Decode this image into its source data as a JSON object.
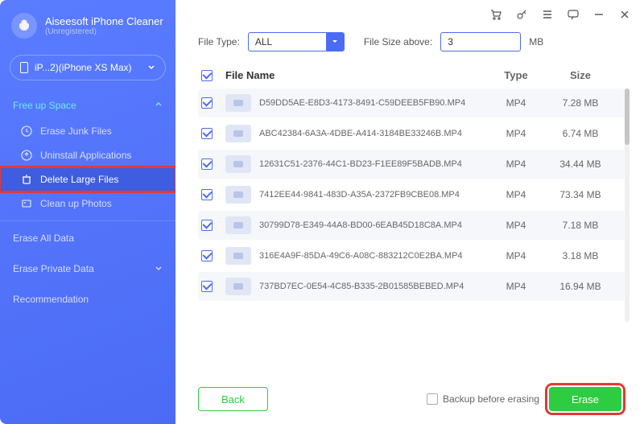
{
  "brand": {
    "title": "Aiseesoft iPhone Cleaner",
    "subtitle": "(Unregistered)"
  },
  "device": {
    "label": "iP...2)(iPhone XS Max)"
  },
  "nav": {
    "section1_title": "Free up Space",
    "items": [
      {
        "label": "Erase Junk Files"
      },
      {
        "label": "Uninstall Applications"
      },
      {
        "label": "Delete Large Files"
      },
      {
        "label": "Clean up Photos"
      }
    ],
    "erase_all": "Erase All Data",
    "erase_private": "Erase Private Data",
    "recommendation": "Recommendation"
  },
  "filter": {
    "type_label": "File Type:",
    "type_value": "ALL",
    "size_label": "File Size above:",
    "size_value": "3",
    "size_unit": "MB"
  },
  "table": {
    "headers": {
      "name": "File Name",
      "type": "Type",
      "size": "Size"
    },
    "rows": [
      {
        "name": "D59DD5AE-E8D3-4173-8491-C59DEEB5FB90.MP4",
        "type": "MP4",
        "size": "7.28 MB"
      },
      {
        "name": "ABC42384-6A3A-4DBE-A414-3184BE33246B.MP4",
        "type": "MP4",
        "size": "6.74 MB"
      },
      {
        "name": "12631C51-2376-44C1-BD23-F1EE89F5BADB.MP4",
        "type": "MP4",
        "size": "34.44 MB"
      },
      {
        "name": "7412EE44-9841-483D-A35A-2372FB9CBE08.MP4",
        "type": "MP4",
        "size": "73.34 MB"
      },
      {
        "name": "30799D78-E349-44A8-BD00-6EAB45D18C8A.MP4",
        "type": "MP4",
        "size": "7.18 MB"
      },
      {
        "name": "316E4A9F-85DA-49C6-A08C-883212C0E2BA.MP4",
        "type": "MP4",
        "size": "3.18 MB"
      },
      {
        "name": "737BD7EC-0E54-4C85-B335-2B01585BEBED.MP4",
        "type": "MP4",
        "size": "16.94 MB"
      }
    ]
  },
  "footer": {
    "back": "Back",
    "backup": "Backup before erasing",
    "erase": "Erase"
  }
}
